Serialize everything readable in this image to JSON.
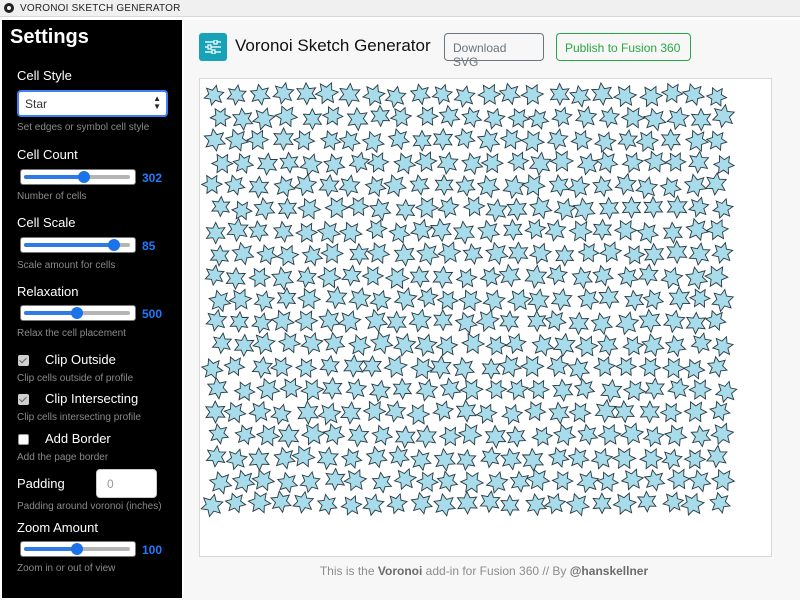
{
  "window": {
    "title": "VORONOI SKETCH GENERATOR"
  },
  "sidebar": {
    "title": "Settings",
    "cell_style": {
      "label": "Cell Style",
      "value": "Star",
      "help": "Set edges or symbol cell style"
    },
    "cell_count": {
      "label": "Cell Count",
      "value": "302",
      "level": 0.57,
      "help": "Number of cells"
    },
    "cell_scale": {
      "label": "Cell Scale",
      "value": "85",
      "level": 0.85,
      "help": "Scale amount for cells"
    },
    "relaxation": {
      "label": "Relaxation",
      "value": "500",
      "level": 0.5,
      "help": "Relax the cell placement"
    },
    "clip_outside": {
      "label": "Clip Outside",
      "checked": true,
      "help": "Clip cells outside of profile"
    },
    "clip_intersecting": {
      "label": "Clip Intersecting",
      "checked": true,
      "help": "Clip cells intersecting profile"
    },
    "add_border": {
      "label": "Add Border",
      "checked": false,
      "help": "Add the page border"
    },
    "padding": {
      "label": "Padding",
      "placeholder": "0",
      "help": "Padding around voronoi (inches)"
    },
    "zoom": {
      "label": "Zoom Amount",
      "value": "100",
      "level": 0.5,
      "help": "Zoom in or out of view"
    }
  },
  "header": {
    "title": "Voronoi Sketch Generator",
    "download_label": "Download SVG",
    "publish_label": "Publish to Fusion 360"
  },
  "canvas": {
    "star_fill": "#a8dcea",
    "star_stroke": "#2a3a44",
    "rows": 19,
    "cols": 23
  },
  "footer": {
    "prefix": "This is the ",
    "name": "Voronoi",
    "middle": " add-in for Fusion 360 // By ",
    "author": "@hanskellner"
  },
  "colors": {
    "accent": "#1e7bff",
    "teal": "#17a2b8",
    "green": "#28a745",
    "grey": "#6c757d"
  }
}
